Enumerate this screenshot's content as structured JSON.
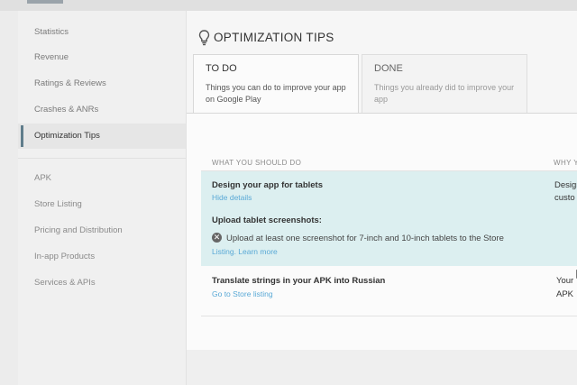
{
  "sidebar": {
    "items": [
      {
        "label": "Statistics"
      },
      {
        "label": "Revenue"
      },
      {
        "label": "Ratings & Reviews"
      },
      {
        "label": "Crashes & ANRs"
      },
      {
        "label": "Optimization Tips"
      },
      {
        "label": "APK"
      },
      {
        "label": "Store Listing"
      },
      {
        "label": "Pricing and Distribution"
      },
      {
        "label": "In-app Products"
      },
      {
        "label": "Services & APIs"
      }
    ],
    "active_index": 4
  },
  "main": {
    "icon": "lightbulb-icon",
    "title": "OPTIMIZATION TIPS",
    "tabs": [
      {
        "label": "TO DO",
        "description": "Things you can do to improve your app on Google Play"
      },
      {
        "label": "DONE",
        "description": "Things you already did to improve your app"
      }
    ],
    "active_tab": 0,
    "columns": {
      "what": "WHAT YOU SHOULD DO",
      "why": "WHY Y"
    },
    "tips": [
      {
        "title": "Design your app for tablets",
        "link": "Hide details",
        "why": [
          "Design",
          "custo"
        ],
        "subtitle": "Upload tablet screenshots:",
        "error_icon": "x-circle-icon",
        "error_text": "Upload at least one screenshot for 7-inch and 10-inch tablets to the Store",
        "error_link": "Listing. Learn more"
      },
      {
        "title": "Translate strings in your APK into Russian",
        "link": "Go to Store listing",
        "why": [
          "Your",
          "APK"
        ]
      }
    ]
  },
  "colors": {
    "highlight_row": "#dceff0",
    "link": "#5aa9d6",
    "active_indicator": "#607d8b"
  }
}
